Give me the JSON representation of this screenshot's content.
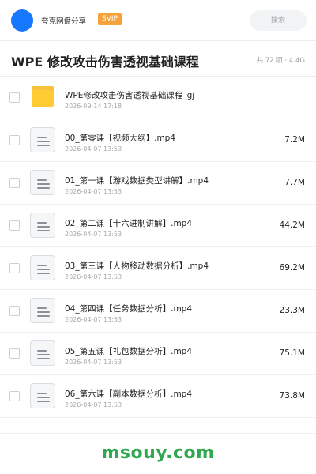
{
  "header": {
    "app_name": "夸克网盘分享",
    "badge": "SVIP",
    "search_placeholder": "搜索",
    "avatar_color": "#1677ff",
    "badge_color": "#f7a13b"
  },
  "title_bar": {
    "title": "WPE 修改攻击伤害透视基础课程",
    "summary": "共 72 项 · 4.4G"
  },
  "files": [
    {
      "type": "folder",
      "icon": "folder-icon",
      "name": "WPE修改攻击伤害透视基础课程_gj",
      "date": "2026-09-14 17:18",
      "size": ""
    },
    {
      "type": "file",
      "icon": "document-icon",
      "name": "00_第零课【视频大纲】.mp4",
      "date": "2026-04-07 13:53",
      "size": "7.2M"
    },
    {
      "type": "file",
      "icon": "document-icon",
      "name": "01_第一课【游戏数据类型讲解】.mp4",
      "date": "2026-04-07 13:53",
      "size": "7.7M"
    },
    {
      "type": "file",
      "icon": "document-icon",
      "name": "02_第二课【十六进制讲解】.mp4",
      "date": "2026-04-07 13:53",
      "size": "44.2M"
    },
    {
      "type": "file",
      "icon": "document-icon",
      "name": "03_第三课【人物移动数据分析】.mp4",
      "date": "2026-04-07 13:53",
      "size": "69.2M"
    },
    {
      "type": "file",
      "icon": "document-icon",
      "name": "04_第四课【任务数据分析】.mp4",
      "date": "2026-04-07 13:53",
      "size": "23.3M"
    },
    {
      "type": "file",
      "icon": "document-icon",
      "name": "05_第五课【礼包数据分析】.mp4",
      "date": "2026-04-07 13:53",
      "size": "75.1M"
    },
    {
      "type": "file",
      "icon": "document-icon",
      "name": "06_第六课【副本数据分析】.mp4",
      "date": "2026-04-07 13:53",
      "size": "73.8M"
    }
  ],
  "footer": {
    "watermark": "msouy.com",
    "watermark_color": "#2fa84f"
  }
}
